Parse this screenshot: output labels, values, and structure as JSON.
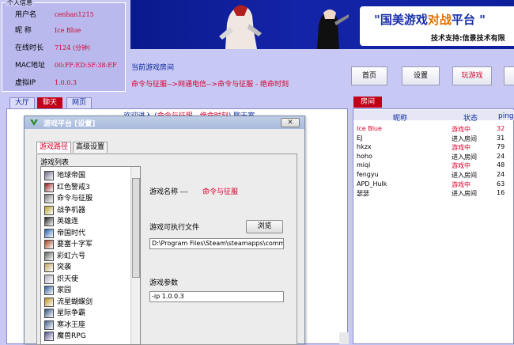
{
  "user_info": {
    "legend": "个人信息",
    "rows": [
      {
        "label": "用户名",
        "value": "cenhan1215"
      },
      {
        "label": "昵  称",
        "value": "Ice Blue"
      },
      {
        "label": "在线时长",
        "value": "7124 (分钟)"
      },
      {
        "label": "MAC地址",
        "value": "00:FF:ED:5F:38:EF"
      },
      {
        "label": "虚拟IP",
        "value": "1.0.0.3"
      }
    ]
  },
  "banner": {
    "slogan_prefix": "\"国美游戏",
    "slogan_mid": "对战",
    "slogan_suffix": "平台 \"",
    "support": "技术支持:信景技术有限"
  },
  "room": {
    "title": "当前游戏房间",
    "path": "命令与征服-->网通电信-->命令与征服    -  绝命时刻"
  },
  "nav": {
    "home": "首页",
    "settings": "设置",
    "play": "玩游戏"
  },
  "tabs": [
    "大厅",
    "聊天",
    "网页"
  ],
  "chat": {
    "prefix": "------  欢迎进入  (",
    "room": "命令与征服    -  绝命时刻",
    "suffix": ")  聊天室  ------"
  },
  "dialog": {
    "title": "游戏平台 [设置]",
    "close": "✕",
    "tabs": [
      "游戏路径",
      "高级设置"
    ],
    "list_label": "游戏列表",
    "games": [
      {
        "name": "地球帝国",
        "icon_color": "#6b6b8a"
      },
      {
        "name": "红色警戒3",
        "icon_color": "#9a1a1a"
      },
      {
        "name": "命令与征服",
        "icon_color": "#7a7a7a"
      },
      {
        "name": "战争机器",
        "icon_color": "#b8a030"
      },
      {
        "name": "英雄连",
        "icon_color": "#222222"
      },
      {
        "name": "帝国时代",
        "icon_color": "#2060b0"
      },
      {
        "name": "要塞十字军",
        "icon_color": "#a04020"
      },
      {
        "name": "彩虹六号",
        "icon_color": "#606060"
      },
      {
        "name": "突袭",
        "icon_color": "#c0a060"
      },
      {
        "name": "炽天使",
        "icon_color": "#b0b0c0"
      },
      {
        "name": "家园",
        "icon_color": "#3060a0"
      },
      {
        "name": "流星蝴蝶剑",
        "icon_color": "#c09020"
      },
      {
        "name": "星际争霸",
        "icon_color": "#305080"
      },
      {
        "name": "寒冰王座",
        "icon_color": "#406090"
      },
      {
        "name": "魔兽RPG",
        "icon_color": "#505090"
      }
    ],
    "game_name_label": "游戏名称  ---",
    "game_name_value": "命令与征服",
    "exe_label": "游戏可执行文件",
    "browse": "浏览",
    "exe_path": "D:\\Program Files\\Steam\\steamapps\\common\\le",
    "params_label": "游戏参数",
    "params_value": "-ip 1.0.0.3"
  },
  "room_list": {
    "tab": "房间",
    "headers": [
      "昵称",
      "状态",
      "ping"
    ],
    "rows": [
      {
        "name": "Ice Blue",
        "status": "游戏中",
        "score": "32",
        "self": true
      },
      {
        "name": "EJ",
        "status": "进入房间",
        "score": "31",
        "self": false
      },
      {
        "name": "hkzx",
        "status": "游戏中",
        "score": "79",
        "self": false
      },
      {
        "name": "hoho",
        "status": "进入房间",
        "score": "24",
        "self": false
      },
      {
        "name": "miqi",
        "status": "游戏中",
        "score": "48",
        "self": false
      },
      {
        "name": "fengyu",
        "status": "进入房间",
        "score": "24",
        "self": false
      },
      {
        "name": "APD_Hulk",
        "status": "游戏中",
        "score": "63",
        "self": false
      },
      {
        "name": "瑟瑟",
        "status": "进入房间",
        "score": "16",
        "self": false
      }
    ]
  },
  "colors": {
    "accent_red": "#d8002c",
    "link_blue": "#0a2a9c"
  }
}
